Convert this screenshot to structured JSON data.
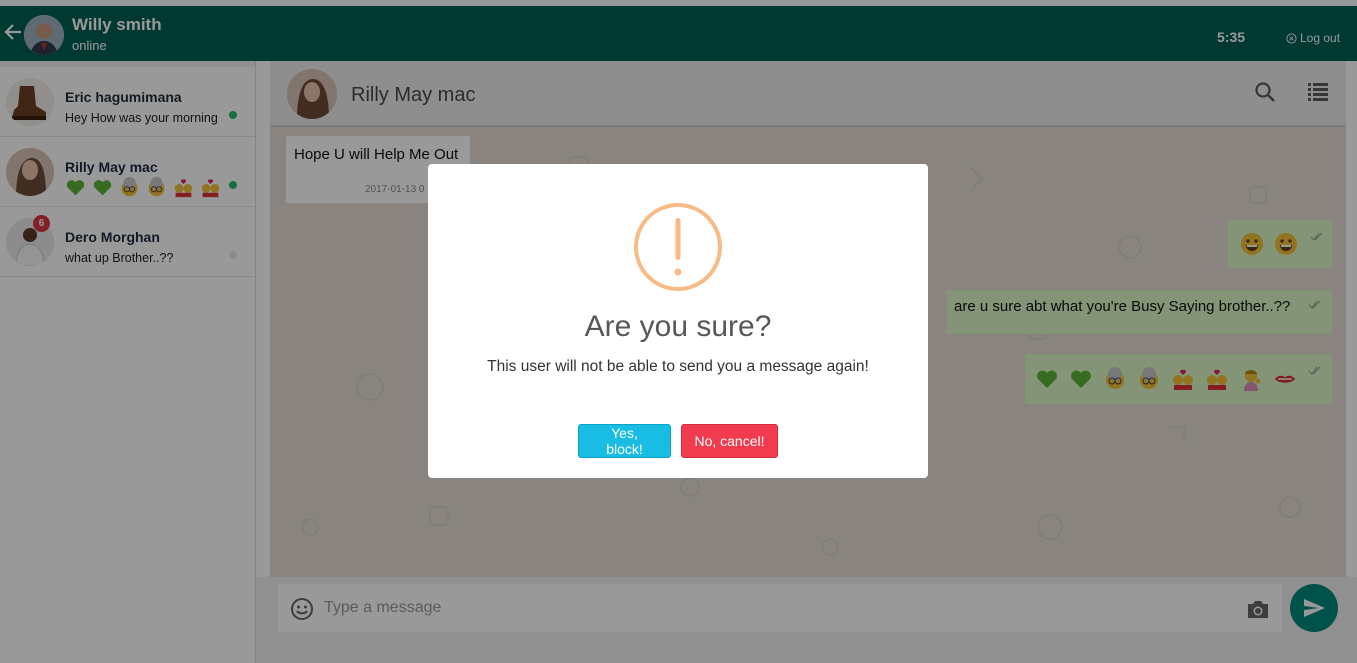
{
  "topbar": {
    "user_name": "Willy smith",
    "user_status": "online",
    "time": "5:35",
    "logout_label": "Log out"
  },
  "sidebar": {
    "chats": [
      {
        "name": "Eric hagumimana",
        "preview": "Hey How was your morning",
        "online": true
      },
      {
        "name": "Rilly May mac",
        "preview_emojis": [
          "green-heart",
          "green-heart",
          "older-woman",
          "older-woman",
          "kiss-couple",
          "kiss-couple"
        ],
        "online": true
      },
      {
        "name": "Dero Morghan",
        "preview": "what up Brother..??",
        "unread": "6",
        "online": false
      }
    ]
  },
  "conversation": {
    "contact_name": "Rilly May mac",
    "messages": [
      {
        "direction": "in",
        "text": "Hope U will Help Me Out",
        "time": "2017-01-13 0"
      },
      {
        "direction": "out",
        "emojis": [
          "grinning-face",
          "grinning-face"
        ]
      },
      {
        "direction": "out",
        "text": "are u sure abt what you're Busy Saying brother..??"
      },
      {
        "direction": "out",
        "emojis": [
          "green-heart",
          "green-heart",
          "older-woman",
          "older-woman",
          "kiss-couple",
          "kiss-couple",
          "woman-tipping-hand",
          "mouth"
        ]
      }
    ],
    "input_placeholder": "Type a message"
  },
  "modal": {
    "title": "Are you sure?",
    "text": "This user will not be able to send you a message again!",
    "confirm_label": "Yes, block!",
    "cancel_label": "No, cancel!"
  },
  "colors": {
    "header": "#005e54",
    "outgoing_bubble": "#dcf8c6",
    "warning": "#f8bb86",
    "confirm_button": "#19bde3",
    "cancel_button": "#f03c4e",
    "online": "#25b96a",
    "send_button": "#008a7c"
  }
}
